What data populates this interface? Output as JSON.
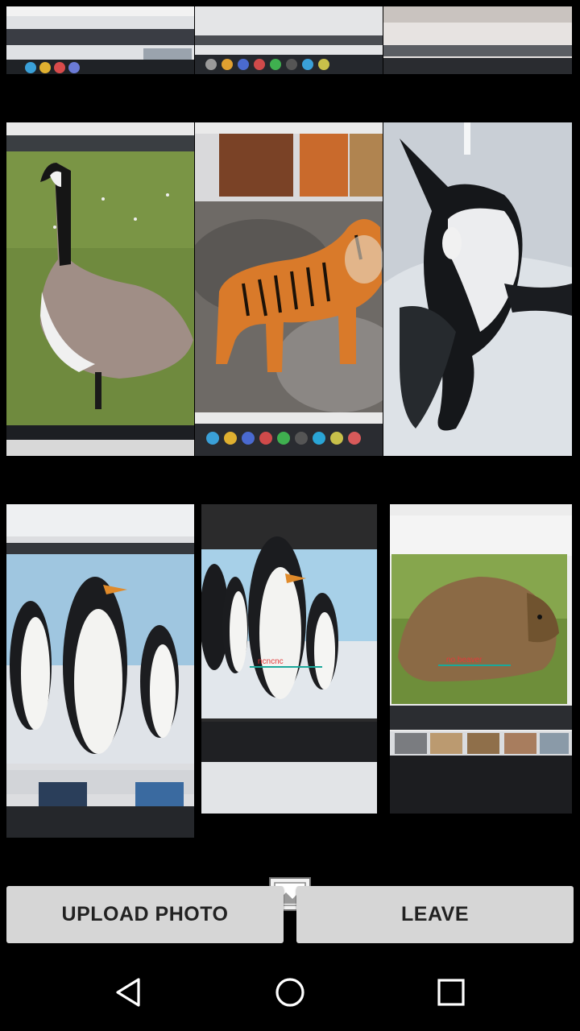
{
  "buttons": {
    "upload_label": "UPLOAD PHOTO",
    "leave_label": "LEAVE"
  },
  "icons": {
    "gallery": "image-gallery-icon",
    "back": "back-triangle-icon",
    "home": "home-circle-icon",
    "recents": "recents-square-icon"
  },
  "photos": {
    "row1": [
      "partial-photo-1",
      "partial-photo-2",
      "partial-photo-3"
    ],
    "row2": [
      "canada-goose",
      "tiger",
      "orca"
    ],
    "row3": [
      "penguins",
      "penguins-annotated",
      "beaver"
    ],
    "annotations": {
      "penguins": "ncncnc",
      "beaver": "no beaver"
    }
  },
  "colors": {
    "button_bg": "#d6d6d6",
    "nav_bg": "#000000",
    "annotation_red": "#e23b3b",
    "annotation_teal": "#1aa89a"
  }
}
